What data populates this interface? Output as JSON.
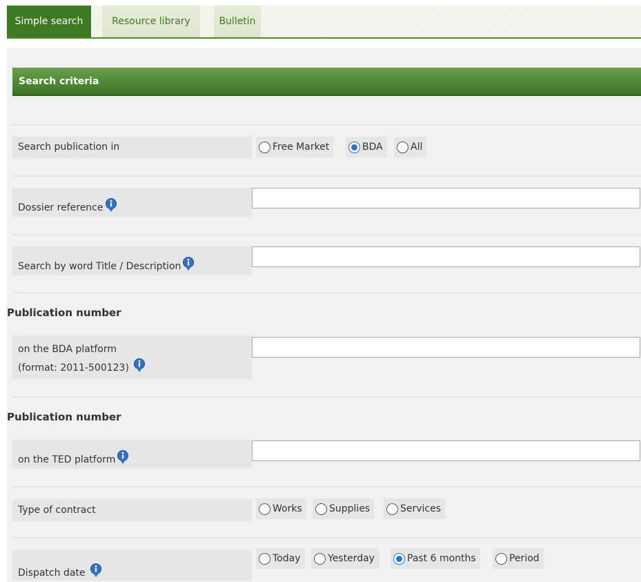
{
  "tabs": [
    {
      "label": "Simple search",
      "active": true
    },
    {
      "label": "Resource library",
      "active": false
    },
    {
      "label": "Bulletin",
      "active": false
    }
  ],
  "panel": {
    "header": "Search criteria"
  },
  "form": {
    "publication_in": {
      "label": "Search publication in",
      "options": [
        {
          "label": "Free Market",
          "checked": false
        },
        {
          "label": "BDA",
          "checked": true
        },
        {
          "label": "All",
          "checked": false
        }
      ]
    },
    "dossier_reference": {
      "label": "Dossier reference",
      "value": ""
    },
    "search_by_word": {
      "label": "Search by word Title / Description",
      "value": ""
    },
    "bda_publication": {
      "section": "Publication number",
      "label_line1": "on the BDA platform",
      "label_line2": "(format: 2011-500123)",
      "value": ""
    },
    "ted_publication": {
      "section": "Publication number",
      "label": "on the TED platform",
      "value": ""
    },
    "contract_type": {
      "label": "Type of contract",
      "options": [
        {
          "label": "Works",
          "checked": false
        },
        {
          "label": "Supplies",
          "checked": false
        },
        {
          "label": "Services",
          "checked": false
        }
      ]
    },
    "dispatch_date": {
      "label": "Dispatch date",
      "options": [
        {
          "label": "Today",
          "checked": false
        },
        {
          "label": "Yesterday",
          "checked": false
        },
        {
          "label": "Past 6 months",
          "checked": true
        },
        {
          "label": "Period",
          "checked": false
        }
      ]
    }
  },
  "colors": {
    "accent_green": "#3f7a23",
    "radio_blue": "#2a74d8"
  },
  "icons": {
    "info": "info-icon"
  }
}
